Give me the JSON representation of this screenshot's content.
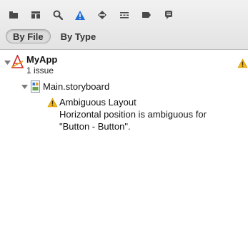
{
  "toolbar": {
    "icons": [
      "project-navigator-icon",
      "symbol-navigator-icon",
      "search-icon",
      "issue-navigator-icon",
      "test-navigator-icon",
      "debug-navigator-icon",
      "breakpoint-navigator-icon",
      "log-navigator-icon"
    ],
    "colors": {
      "accent": "#1f6fd6",
      "icon_gray": "#4a4a4a",
      "warning": "#f2b61a"
    }
  },
  "scope": {
    "by_file_label": "By File",
    "by_type_label": "By Type",
    "selected": "By File"
  },
  "issues": {
    "project": {
      "name": "MyApp",
      "issue_count": "1 issue"
    },
    "file": {
      "name": "Main.storyboard"
    },
    "issue": {
      "title": "Ambiguous Layout",
      "message_line1": "Horizontal position is ambiguous for",
      "message_line2": "\"Button - Button\"."
    }
  }
}
